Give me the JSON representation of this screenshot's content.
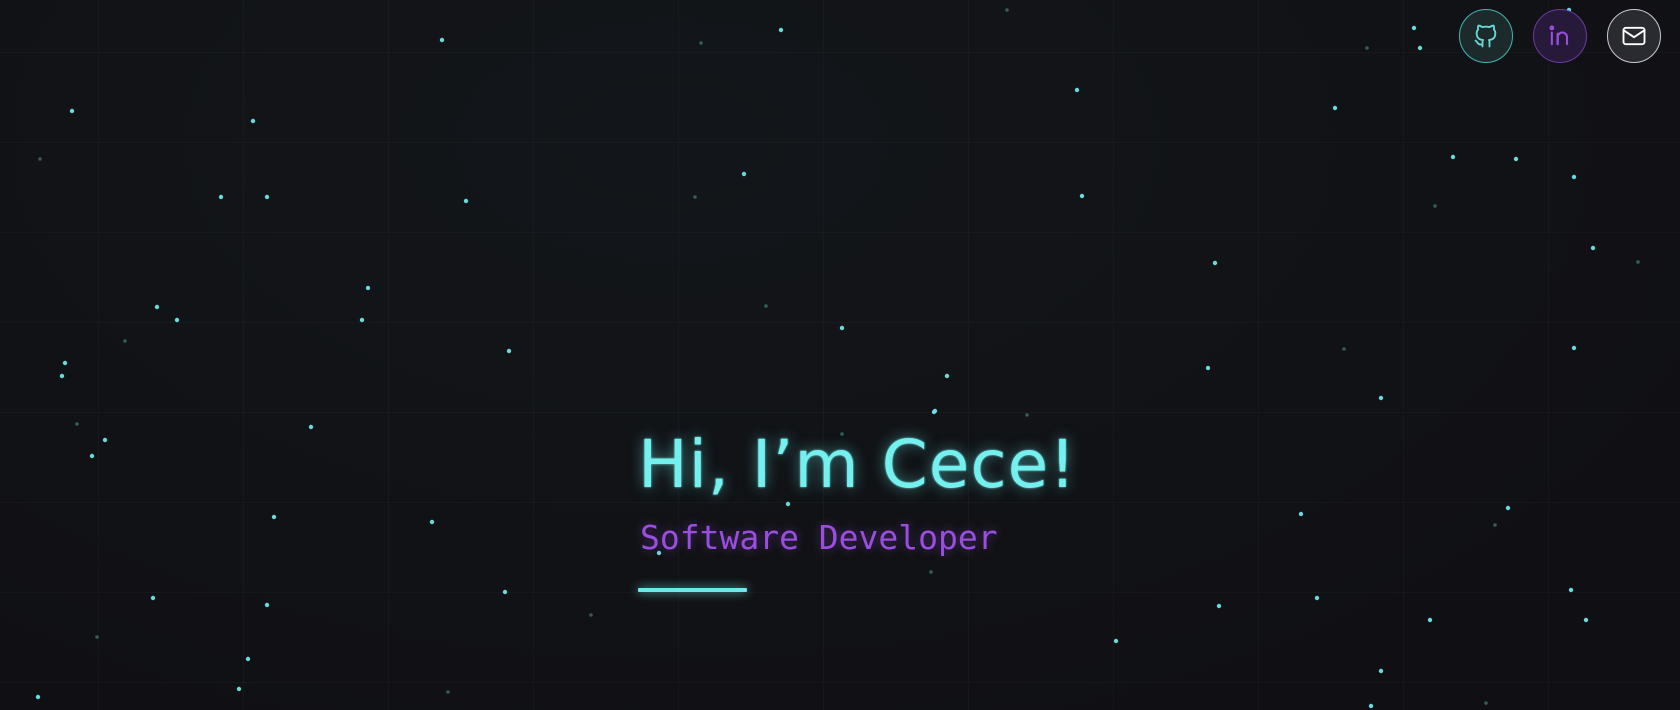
{
  "hero": {
    "title": "Hi, I’m Cece!",
    "subtitle": "Software Developer"
  },
  "social": [
    {
      "name": "github-link",
      "icon": "github-icon",
      "color": "#67d8d4"
    },
    {
      "name": "linkedin-link",
      "icon": "linkedin-icon",
      "color": "#9a4ee0"
    },
    {
      "name": "email-link",
      "icon": "mail-icon",
      "color": "#ffffff"
    }
  ],
  "colors": {
    "background": "#111215",
    "accent_cyan": "#74f0ef",
    "accent_purple": "#9a4ee0",
    "star_bright": "#6ee6e6",
    "star_dim": "#3f7f7c"
  }
}
